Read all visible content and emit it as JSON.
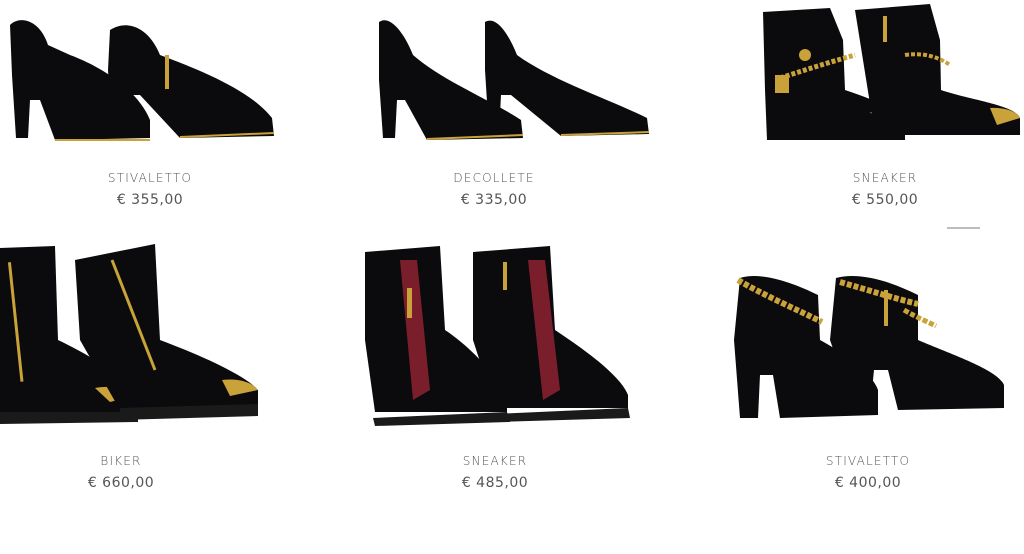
{
  "products": [
    {
      "name": "STIVALETTO",
      "price": "€ 355,00",
      "image": "suede-zip-ankle-bootie"
    },
    {
      "name": "DECOLLETE",
      "price": "€ 335,00",
      "image": "suede-pump"
    },
    {
      "name": "SNEAKER",
      "price": "€ 550,00",
      "image": "chain-strap-high-top-sneaker"
    },
    {
      "name": "BIKER",
      "price": "€ 660,00",
      "image": "studded-biker-boot"
    },
    {
      "name": "SNEAKER",
      "price": "€ 485,00",
      "image": "lace-up-wedge-sneaker"
    },
    {
      "name": "STIVALETTO",
      "price": "€ 400,00",
      "image": "chain-platform-bootie"
    }
  ],
  "colors": {
    "text": "#555555",
    "shoe": "#0b0b0d",
    "gold": "#c9a23a",
    "burgundy": "#7a1e2c",
    "divider": "#bdbdbd"
  }
}
